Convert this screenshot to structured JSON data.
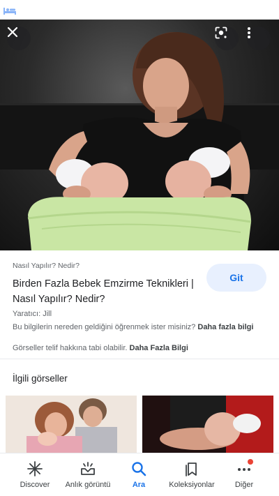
{
  "colors": {
    "accent": "#1a73e8",
    "visit_button_bg": "#e8f0fe",
    "secondary_text": "#5f6368",
    "notification_dot": "#ea4335"
  },
  "status_bar": {
    "icon": "bed-icon"
  },
  "viewer": {
    "close_icon": "close-icon",
    "lens_icon": "lens-icon",
    "more_icon": "more-vert-icon"
  },
  "result": {
    "source": "Nasıl Yapılır? Nedir?",
    "title": "Birden Fazla Bebek Emzirme Teknikleri | Nasıl Yapılır? Nedir?",
    "visit_label": "Git",
    "creator": "Yaratıcı: Jill",
    "info_text": "Bu bilgilerin nereden geldiğini öğrenmek ister misiniz?",
    "info_link": "Daha fazla bilgi",
    "copyright_text": "Görseller telif hakkına tabi olabilir.",
    "copyright_link": "Daha Fazla Bilgi"
  },
  "related": {
    "heading": "İlgili görseller"
  },
  "bottom_nav": {
    "items": [
      {
        "label": "Discover",
        "icon": "asterisk-icon",
        "active": false
      },
      {
        "label": "Anlık görüntü",
        "icon": "snapshot-icon",
        "active": false
      },
      {
        "label": "Ara",
        "icon": "search-icon",
        "active": true
      },
      {
        "label": "Koleksiyonlar",
        "icon": "collections-icon",
        "active": false
      },
      {
        "label": "Diğer",
        "icon": "more-horiz-icon",
        "active": false,
        "badge": true
      }
    ]
  }
}
